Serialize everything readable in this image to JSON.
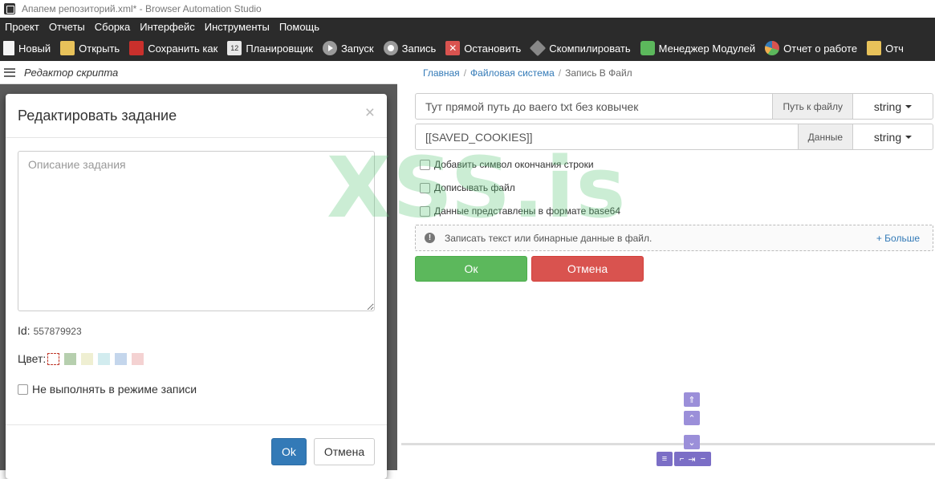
{
  "window": {
    "title": "Апапем репозиторий.xml* - Browser Automation Studio"
  },
  "menu": [
    "Проект",
    "Отчеты",
    "Сборка",
    "Интерфейс",
    "Инструменты",
    "Помощь"
  ],
  "toolbar": {
    "new": "Новый",
    "open": "Открыть",
    "save_as": "Сохранить как",
    "scheduler": "Планировщик",
    "scheduler_icon_text": "12",
    "run": "Запуск",
    "record": "Запись",
    "stop": "Остановить",
    "compile": "Скомпилировать",
    "modules": "Менеджер Модулей",
    "report": "Отчет о работе",
    "other": "Отч"
  },
  "left_panel": {
    "title": "Редактор скрипта"
  },
  "modal": {
    "title": "Редактировать задание",
    "close": "×",
    "description_placeholder": "Описание задания",
    "id_label": "Id:",
    "id_value": "557879923",
    "color_label": "Цвет:",
    "colors": [
      "none",
      "#b6cfae",
      "#efefd2",
      "#d2ecef",
      "#c4d6ec",
      "#f4d2d2"
    ],
    "no_record_label": "Не выполнять в режиме записи",
    "ok": "Ok",
    "cancel": "Отмена"
  },
  "breadcrumb": {
    "home": "Главная",
    "fs": "Файловая система",
    "current": "Запись В Файл"
  },
  "form": {
    "path_value": "Тут прямой путь до ваего txt без ковычек",
    "path_label": "Путь к файлу",
    "path_type": "string",
    "data_value": "[[SAVED_COOKIES]]",
    "data_label": "Данные",
    "data_type": "string",
    "opt_newline": "Добавить символ окончания строки",
    "opt_append": "Дописывать файл",
    "opt_base64": "Данные представлены в формате base64",
    "info_text": "Записать текст или бинарные данные в файл.",
    "more": "+ Больше",
    "ok": "Ок",
    "cancel": "Отмена"
  },
  "watermark": "XSS.is",
  "colors": {
    "accent": "#337ab7",
    "ok": "#5cb85c",
    "cancel": "#d9534f",
    "toolbar": "#2b2b2b",
    "nav": "#9b8fd9"
  }
}
